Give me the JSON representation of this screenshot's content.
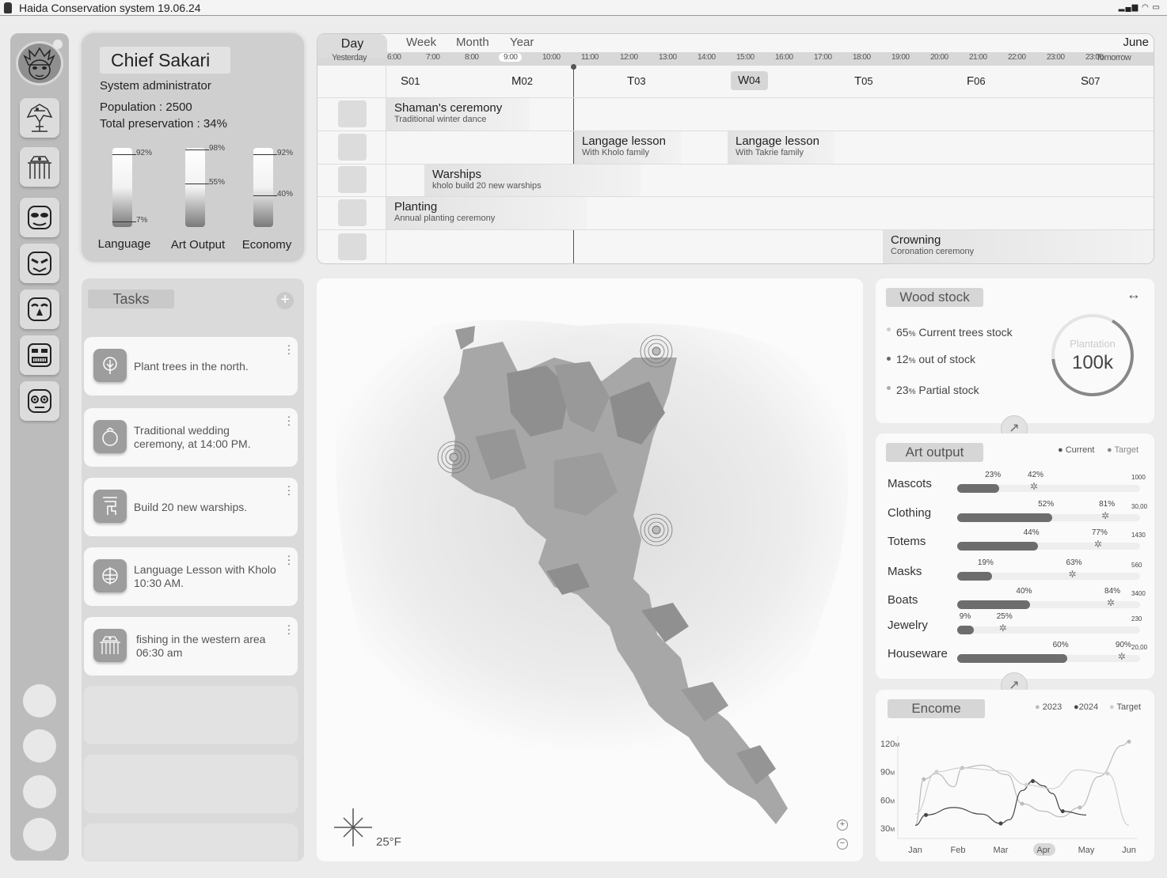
{
  "app": {
    "title": "Haida Conservation system 19.06.24"
  },
  "profile": {
    "name": "Chief Sakari",
    "role": "System administrator",
    "population": "Population : 2500",
    "preservation": "Total preservation : 34%",
    "gauges": [
      {
        "name": "Language",
        "top_label": "92%",
        "low_label": "7%",
        "level": 0.92,
        "low": 0.07
      },
      {
        "name": "Art Output",
        "top_label": "98%",
        "low_label": "55%",
        "level": 0.98,
        "low": 0.55
      },
      {
        "name": "Economy",
        "top_label": "92%",
        "low_label": "40%",
        "level": 0.92,
        "low": 0.4
      }
    ]
  },
  "rail": {
    "icons": [
      "haida-mask-avatar",
      "eagle-icon",
      "thunderbird-icon",
      "bear-face-icon",
      "wolf-face-icon",
      "raven-face-icon",
      "frog-face-icon",
      "owl-face-icon"
    ]
  },
  "calendar": {
    "tabs": [
      "Day",
      "Week",
      "Month",
      "Year"
    ],
    "month": "June",
    "yesterday": "Yesterday",
    "tomorrow": "Tomorrow",
    "hours": [
      "6:00",
      "7:00",
      "8:00",
      "9:00",
      "10:00",
      "11:00",
      "12:00",
      "13:00",
      "14:00",
      "15:00",
      "16:00",
      "17:00",
      "18:00",
      "19:00",
      "20:00",
      "21:00",
      "22:00",
      "23:00",
      "23:00"
    ],
    "current_hour": "9:00",
    "days": [
      {
        "letter": "S",
        "num": "01"
      },
      {
        "letter": "M",
        "num": "02"
      },
      {
        "letter": "T",
        "num": "03"
      },
      {
        "letter": "W",
        "num": "04"
      },
      {
        "letter": "T",
        "num": "05"
      },
      {
        "letter": "F",
        "num": "06"
      },
      {
        "letter": "S",
        "num": "07"
      }
    ],
    "events": [
      {
        "title": "Shaman's ceremony",
        "subtitle": "Traditional winter dance"
      },
      {
        "title": "Langage lesson",
        "subtitle": "With Kholo family"
      },
      {
        "title": "Langage lesson",
        "subtitle": "With Takrie family"
      },
      {
        "title": "Warships",
        "subtitle": "kholo build 20 new warships"
      },
      {
        "title": "Planting",
        "subtitle": "Annual planting ceremony"
      },
      {
        "title": "Crowning",
        "subtitle": "Coronation ceremony"
      }
    ]
  },
  "tasks": {
    "title": "Tasks",
    "add": "+",
    "items": [
      {
        "text": "Plant trees in the north.",
        "icon": "tree-icon"
      },
      {
        "text": "Traditional wedding ceremony, at 14:00 PM.",
        "icon": "ring-icon"
      },
      {
        "text": "Build 20 new warships.",
        "icon": "totem-icon"
      },
      {
        "text": "Language Lesson with Kholo 10:30 AM.",
        "icon": "language-icon"
      },
      {
        "text": "fishing in the western area 06:30 am",
        "icon": "thunderbird-icon"
      }
    ]
  },
  "map": {
    "temperature": "25°F",
    "zoom_in": "+",
    "zoom_out": "−"
  },
  "wood": {
    "title": "Wood stock",
    "items": [
      {
        "pct": "65",
        "label": "Current trees stock"
      },
      {
        "pct": "12",
        "label": "out of stock"
      },
      {
        "pct": "23",
        "label": "Partial stock"
      }
    ],
    "ring_label": "Plantation",
    "ring_value": "100k",
    "ring_fraction": 0.65
  },
  "art": {
    "title": "Art output",
    "legend_current": "Current",
    "legend_target": "Target",
    "rows": [
      {
        "name": "Mascots",
        "current": 23,
        "target": 42,
        "max": "1000"
      },
      {
        "name": "Clothing",
        "current": 52,
        "target": 81,
        "max": "30,00"
      },
      {
        "name": "Totems",
        "current": 44,
        "target": 77,
        "max": "1430"
      },
      {
        "name": "Masks",
        "current": 19,
        "target": 63,
        "max": "560"
      },
      {
        "name": "Boats",
        "current": 40,
        "target": 84,
        "max": "3400"
      },
      {
        "name": "Jewelry",
        "current": 9,
        "target": 25,
        "max": "230"
      },
      {
        "name": "Houseware",
        "current": 60,
        "target": 90,
        "max": "20,00"
      }
    ]
  },
  "income": {
    "title": "Encome",
    "legend": [
      "2023",
      "2024",
      "Target"
    ],
    "selected_month": "Apr"
  },
  "chart_data": {
    "type": "line",
    "title": "Encome",
    "categories": [
      "Jan",
      "Feb",
      "Mar",
      "Apr",
      "May",
      "Jun"
    ],
    "yticks": [
      "30M",
      "60M",
      "90M",
      "120M"
    ],
    "ylim": [
      30,
      120
    ],
    "series": [
      {
        "name": "2023",
        "x": [
          0,
          0.2,
          0.5,
          0.9,
          1.1,
          1.55,
          2.15,
          2.5,
          3.0,
          3.4,
          3.85,
          4.3,
          4.85,
          5.0
        ],
        "y": [
          33,
          82,
          88,
          74,
          94,
          97,
          87,
          56,
          48,
          42,
          52,
          85,
          118,
          122
        ]
      },
      {
        "name": "2024",
        "x": [
          0,
          0.25,
          0.9,
          1.55,
          2.0,
          2.2,
          2.5,
          2.75,
          3.0,
          3.2,
          3.45,
          4.0,
          4.0
        ],
        "y": [
          33,
          44,
          52,
          45,
          35,
          39,
          70,
          80,
          75,
          67,
          48,
          44,
          44
        ]
      },
      {
        "name": "Target",
        "x": [
          0,
          0.5,
          1.1,
          2.05,
          2.6,
          3.2,
          3.8,
          4.5,
          5.0
        ],
        "y": [
          45,
          90,
          94,
          91,
          76,
          72,
          92,
          88,
          33
        ]
      }
    ]
  }
}
